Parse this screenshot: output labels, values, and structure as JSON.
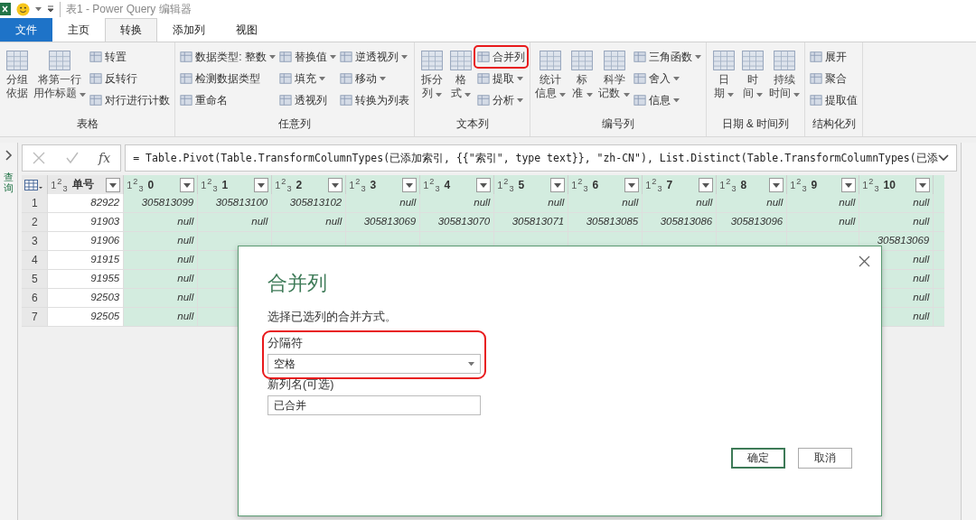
{
  "title_bar": {
    "title": "表1 - Power Query 编辑器"
  },
  "tabs": [
    {
      "label": "文件",
      "kind": "file",
      "selected": false
    },
    {
      "label": "主页",
      "kind": "tab",
      "selected": false
    },
    {
      "label": "转换",
      "kind": "tab",
      "selected": true
    },
    {
      "label": "添加列",
      "kind": "tab",
      "selected": false
    },
    {
      "label": "视图",
      "kind": "tab",
      "selected": false
    }
  ],
  "ribbon": {
    "groups": [
      {
        "label": "表格",
        "items": [
          {
            "kind": "large",
            "lines": [
              "分组",
              "依据"
            ],
            "dropdown": false
          },
          {
            "kind": "large",
            "lines": [
              "将第一行",
              "用作标题"
            ],
            "dropdown": true
          },
          {
            "kind": "stack",
            "items": [
              {
                "label": "转置",
                "dropdown": false,
                "highlighted": false
              },
              {
                "label": "反转行",
                "dropdown": false,
                "highlighted": false
              },
              {
                "label": "对行进行计数",
                "dropdown": false,
                "highlighted": false
              }
            ]
          }
        ]
      },
      {
        "label": "任意列",
        "items": [
          {
            "kind": "stack",
            "items": [
              {
                "label": "数据类型: 整数",
                "dropdown": true,
                "highlighted": false
              },
              {
                "label": "检测数据类型",
                "dropdown": false,
                "highlighted": false
              },
              {
                "label": "重命名",
                "dropdown": false,
                "highlighted": false
              }
            ]
          },
          {
            "kind": "stack",
            "items": [
              {
                "label": "替换值",
                "dropdown": true,
                "highlighted": false
              },
              {
                "label": "填充",
                "dropdown": true,
                "highlighted": false
              },
              {
                "label": "透视列",
                "dropdown": false,
                "highlighted": false
              }
            ]
          },
          {
            "kind": "stack",
            "items": [
              {
                "label": "逆透视列",
                "dropdown": true,
                "highlighted": false
              },
              {
                "label": "移动",
                "dropdown": true,
                "highlighted": false
              },
              {
                "label": "转换为列表",
                "dropdown": false,
                "highlighted": false
              }
            ]
          }
        ]
      },
      {
        "label": "文本列",
        "items": [
          {
            "kind": "large",
            "lines": [
              "拆分",
              "列"
            ],
            "dropdown": true
          },
          {
            "kind": "large",
            "lines": [
              "格",
              "式"
            ],
            "dropdown": true
          },
          {
            "kind": "stack",
            "items": [
              {
                "label": "合并列",
                "dropdown": false,
                "highlighted": true
              },
              {
                "label": "提取",
                "dropdown": true,
                "highlighted": false
              },
              {
                "label": "分析",
                "dropdown": true,
                "highlighted": false
              }
            ]
          }
        ]
      },
      {
        "label": "编号列",
        "items": [
          {
            "kind": "large",
            "lines": [
              "统计",
              "信息"
            ],
            "dropdown": true
          },
          {
            "kind": "large",
            "lines": [
              "标",
              "准"
            ],
            "dropdown": true
          },
          {
            "kind": "large",
            "lines": [
              "科学",
              "记数"
            ],
            "dropdown": true
          },
          {
            "kind": "stack",
            "items": [
              {
                "label": "三角函数",
                "dropdown": true,
                "highlighted": false
              },
              {
                "label": "舍入",
                "dropdown": true,
                "highlighted": false
              },
              {
                "label": "信息",
                "dropdown": true,
                "highlighted": false
              }
            ]
          }
        ]
      },
      {
        "label": "日期 & 时间列",
        "items": [
          {
            "kind": "large",
            "lines": [
              "日",
              "期"
            ],
            "dropdown": true
          },
          {
            "kind": "large",
            "lines": [
              "时",
              "间"
            ],
            "dropdown": true
          },
          {
            "kind": "large",
            "lines": [
              "持续",
              "时间"
            ],
            "dropdown": true
          }
        ]
      },
      {
        "label": "结构化列",
        "items": [
          {
            "kind": "stack",
            "items": [
              {
                "label": "展开",
                "dropdown": false,
                "highlighted": false
              },
              {
                "label": "聚合",
                "dropdown": false,
                "highlighted": false
              },
              {
                "label": "提取值",
                "dropdown": false,
                "highlighted": false
              }
            ]
          }
        ]
      }
    ]
  },
  "queries_pane": {
    "label": "查询"
  },
  "formula_bar": {
    "fx": "fx",
    "formula": "= Table.Pivot(Table.TransformColumnTypes(已添加索引, {{\"索引\", type text}}, \"zh-CN\"), List.Distinct(Table.TransformColumnTypes(已添"
  },
  "table": {
    "columns": [
      {
        "type": "1$^{2}$$_{3}$",
        "name": "单号"
      },
      {
        "type": "1$^{2}$$_{3}$",
        "name": "0"
      },
      {
        "type": "1$^{2}$$_{3}$",
        "name": "1"
      },
      {
        "type": "1$^{2}$$_{3}$",
        "name": "2"
      },
      {
        "type": "1$^{2}$$_{3}$",
        "name": "3"
      },
      {
        "type": "1$^{2}$$_{3}$",
        "name": "4"
      },
      {
        "type": "1$^{2}$$_{3}$",
        "name": "5"
      },
      {
        "type": "1$^{2}$$_{3}$",
        "name": "6"
      },
      {
        "type": "1$^{2}$$_{3}$",
        "name": "7"
      },
      {
        "type": "1$^{2}$$_{3}$",
        "name": "8"
      },
      {
        "type": "1$^{2}$$_{3}$",
        "name": "9"
      },
      {
        "type": "1$^{2}$$_{3}$",
        "name": "10"
      }
    ],
    "rows": [
      {
        "num": "1",
        "id": "82922",
        "cells": [
          "305813099",
          "305813100",
          "305813102",
          "null",
          "null",
          "null",
          "null",
          "null",
          "null",
          "null",
          "null"
        ]
      },
      {
        "num": "2",
        "id": "91903",
        "cells": [
          "null",
          "null",
          "null",
          "305813069",
          "305813070",
          "305813071",
          "305813085",
          "305813086",
          "305813096",
          "null",
          "null"
        ]
      },
      {
        "num": "3",
        "id": "91906",
        "cells": [
          "null"
        ],
        "last": "305813069"
      },
      {
        "num": "4",
        "id": "91915",
        "cells": [
          "null"
        ],
        "last": "null"
      },
      {
        "num": "5",
        "id": "91955",
        "cells": [
          "null"
        ],
        "last": "null"
      },
      {
        "num": "6",
        "id": "92503",
        "cells": [
          "null"
        ],
        "last": "null"
      },
      {
        "num": "7",
        "id": "92505",
        "cells": [
          "null"
        ],
        "last": "null"
      }
    ]
  },
  "dialog": {
    "title": "合并列",
    "description": "选择已选列的合并方式。",
    "separator": {
      "label": "分隔符",
      "value": "空格",
      "highlighted": true
    },
    "new_name": {
      "label": "新列名(可选)",
      "value": "已合并"
    },
    "buttons": [
      {
        "label": "确定",
        "kind": "primary"
      },
      {
        "label": "取消",
        "kind": "secondary"
      }
    ]
  }
}
